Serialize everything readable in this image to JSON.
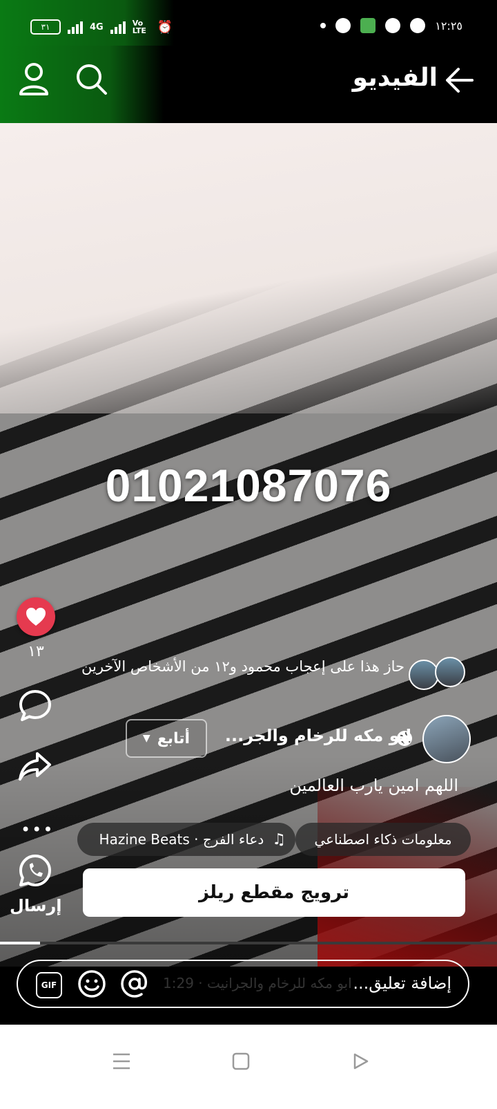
{
  "status_bar": {
    "time": "١٢:٢٥",
    "battery": "٣١",
    "network": "4G",
    "volte": "Vo LTE"
  },
  "header": {
    "title": "الفيديو"
  },
  "video": {
    "overlay_text": "01021087076"
  },
  "actions": {
    "like_count": "١٣",
    "send_label": "إرسال"
  },
  "reactions": {
    "text": "حاز هذا على إعجاب محمود و١٢ من الأشخاص الآخرين"
  },
  "page": {
    "name": "ابو مكه للرخام والجر...",
    "follow_label": "أتابع",
    "caption": "اللهم امين يارب العالمين"
  },
  "chips": {
    "ai_info": "معلومات ذكاء اصطناعي",
    "music": "دعاء الفرج · Hazine Beats"
  },
  "promote": {
    "label": "ترويج مقطع ريلز"
  },
  "progress": {
    "fraction": 0.08
  },
  "comment": {
    "placeholder": "إضافة تعليق...",
    "ghost_text": "ابو مكه للرخام والجرانيت · 1:29"
  },
  "colors": {
    "like": "#e53a4f",
    "accent_green": "#0a7a14"
  }
}
